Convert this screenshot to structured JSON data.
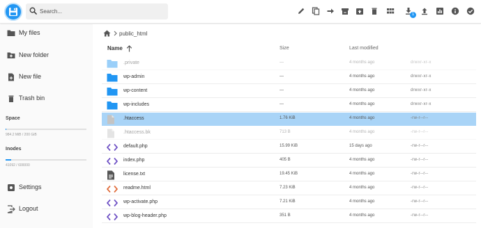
{
  "colors": {
    "accent": "#2196f3",
    "folder": "#2196f3",
    "selected_row": "#a9d4f7",
    "php_icon": "#6d4fc4",
    "html_icon": "#e06b3a"
  },
  "search": {
    "placeholder": "Search..."
  },
  "toolbar": [
    "edit-icon",
    "copy-icon",
    "move-arrow-icon",
    "archive-icon",
    "unarchive-icon",
    "delete-icon",
    "grid-view-icon",
    "download-icon",
    "upload-icon",
    "info-chart-icon",
    "help-icon",
    "select-all-icon"
  ],
  "toolbar_badge": "1",
  "sidebar": {
    "items": [
      {
        "label": "My files",
        "icon": "folder-icon"
      },
      {
        "label": "New folder",
        "icon": "new-folder-icon"
      },
      {
        "label": "New file",
        "icon": "new-file-icon"
      },
      {
        "label": "Trash bin",
        "icon": "trash-icon"
      }
    ],
    "space": {
      "title": "Space",
      "text": "984.2 MiB / 200 GiB",
      "fraction": 0.005
    },
    "inodes": {
      "title": "Inodes",
      "text": "41092 / 600000",
      "fraction": 0.068
    },
    "bottom": [
      {
        "label": "Settings",
        "icon": "gear-icon"
      },
      {
        "label": "Logout",
        "icon": "logout-icon"
      }
    ]
  },
  "breadcrumb": {
    "path": "public_html"
  },
  "columns": {
    "name": "Name",
    "size": "Size",
    "modified": "Last modified"
  },
  "files": [
    {
      "name": ".private",
      "size": "—",
      "modified": "4 months ago",
      "perm": "drwxr-xr-x",
      "type": "folder",
      "dim": true
    },
    {
      "name": "wp-admin",
      "size": "—",
      "modified": "4 months ago",
      "perm": "drwxr-xr-x",
      "type": "folder"
    },
    {
      "name": "wp-content",
      "size": "—",
      "modified": "4 months ago",
      "perm": "drwxr-xr-x",
      "type": "folder"
    },
    {
      "name": "wp-includes",
      "size": "—",
      "modified": "4 months ago",
      "perm": "drwxr-xr-x",
      "type": "folder"
    },
    {
      "name": ".htaccess",
      "size": "1.76 KiB",
      "modified": "4 months ago",
      "perm": "-rw-r--r--",
      "type": "file",
      "selected": true
    },
    {
      "name": ".htaccess.bk",
      "size": "713 B",
      "modified": "4 months ago",
      "perm": "-rw-r--r--",
      "type": "file",
      "dim": true
    },
    {
      "name": "default.php",
      "size": "15.99 KiB",
      "modified": "15 days ago",
      "perm": "-rw-r--r--",
      "type": "code"
    },
    {
      "name": "index.php",
      "size": "405 B",
      "modified": "4 months ago",
      "perm": "-rw-r--r--",
      "type": "code"
    },
    {
      "name": "license.txt",
      "size": "19.45 KiB",
      "modified": "4 months ago",
      "perm": "-rw-r--r--",
      "type": "text"
    },
    {
      "name": "readme.html",
      "size": "7.23 KiB",
      "modified": "4 months ago",
      "perm": "-rw-r--r--",
      "type": "html"
    },
    {
      "name": "wp-activate.php",
      "size": "7.21 KiB",
      "modified": "4 months ago",
      "perm": "-rw-r--r--",
      "type": "code"
    },
    {
      "name": "wp-blog-header.php",
      "size": "351 B",
      "modified": "4 months ago",
      "perm": "-rw-r--r--",
      "type": "code"
    }
  ]
}
